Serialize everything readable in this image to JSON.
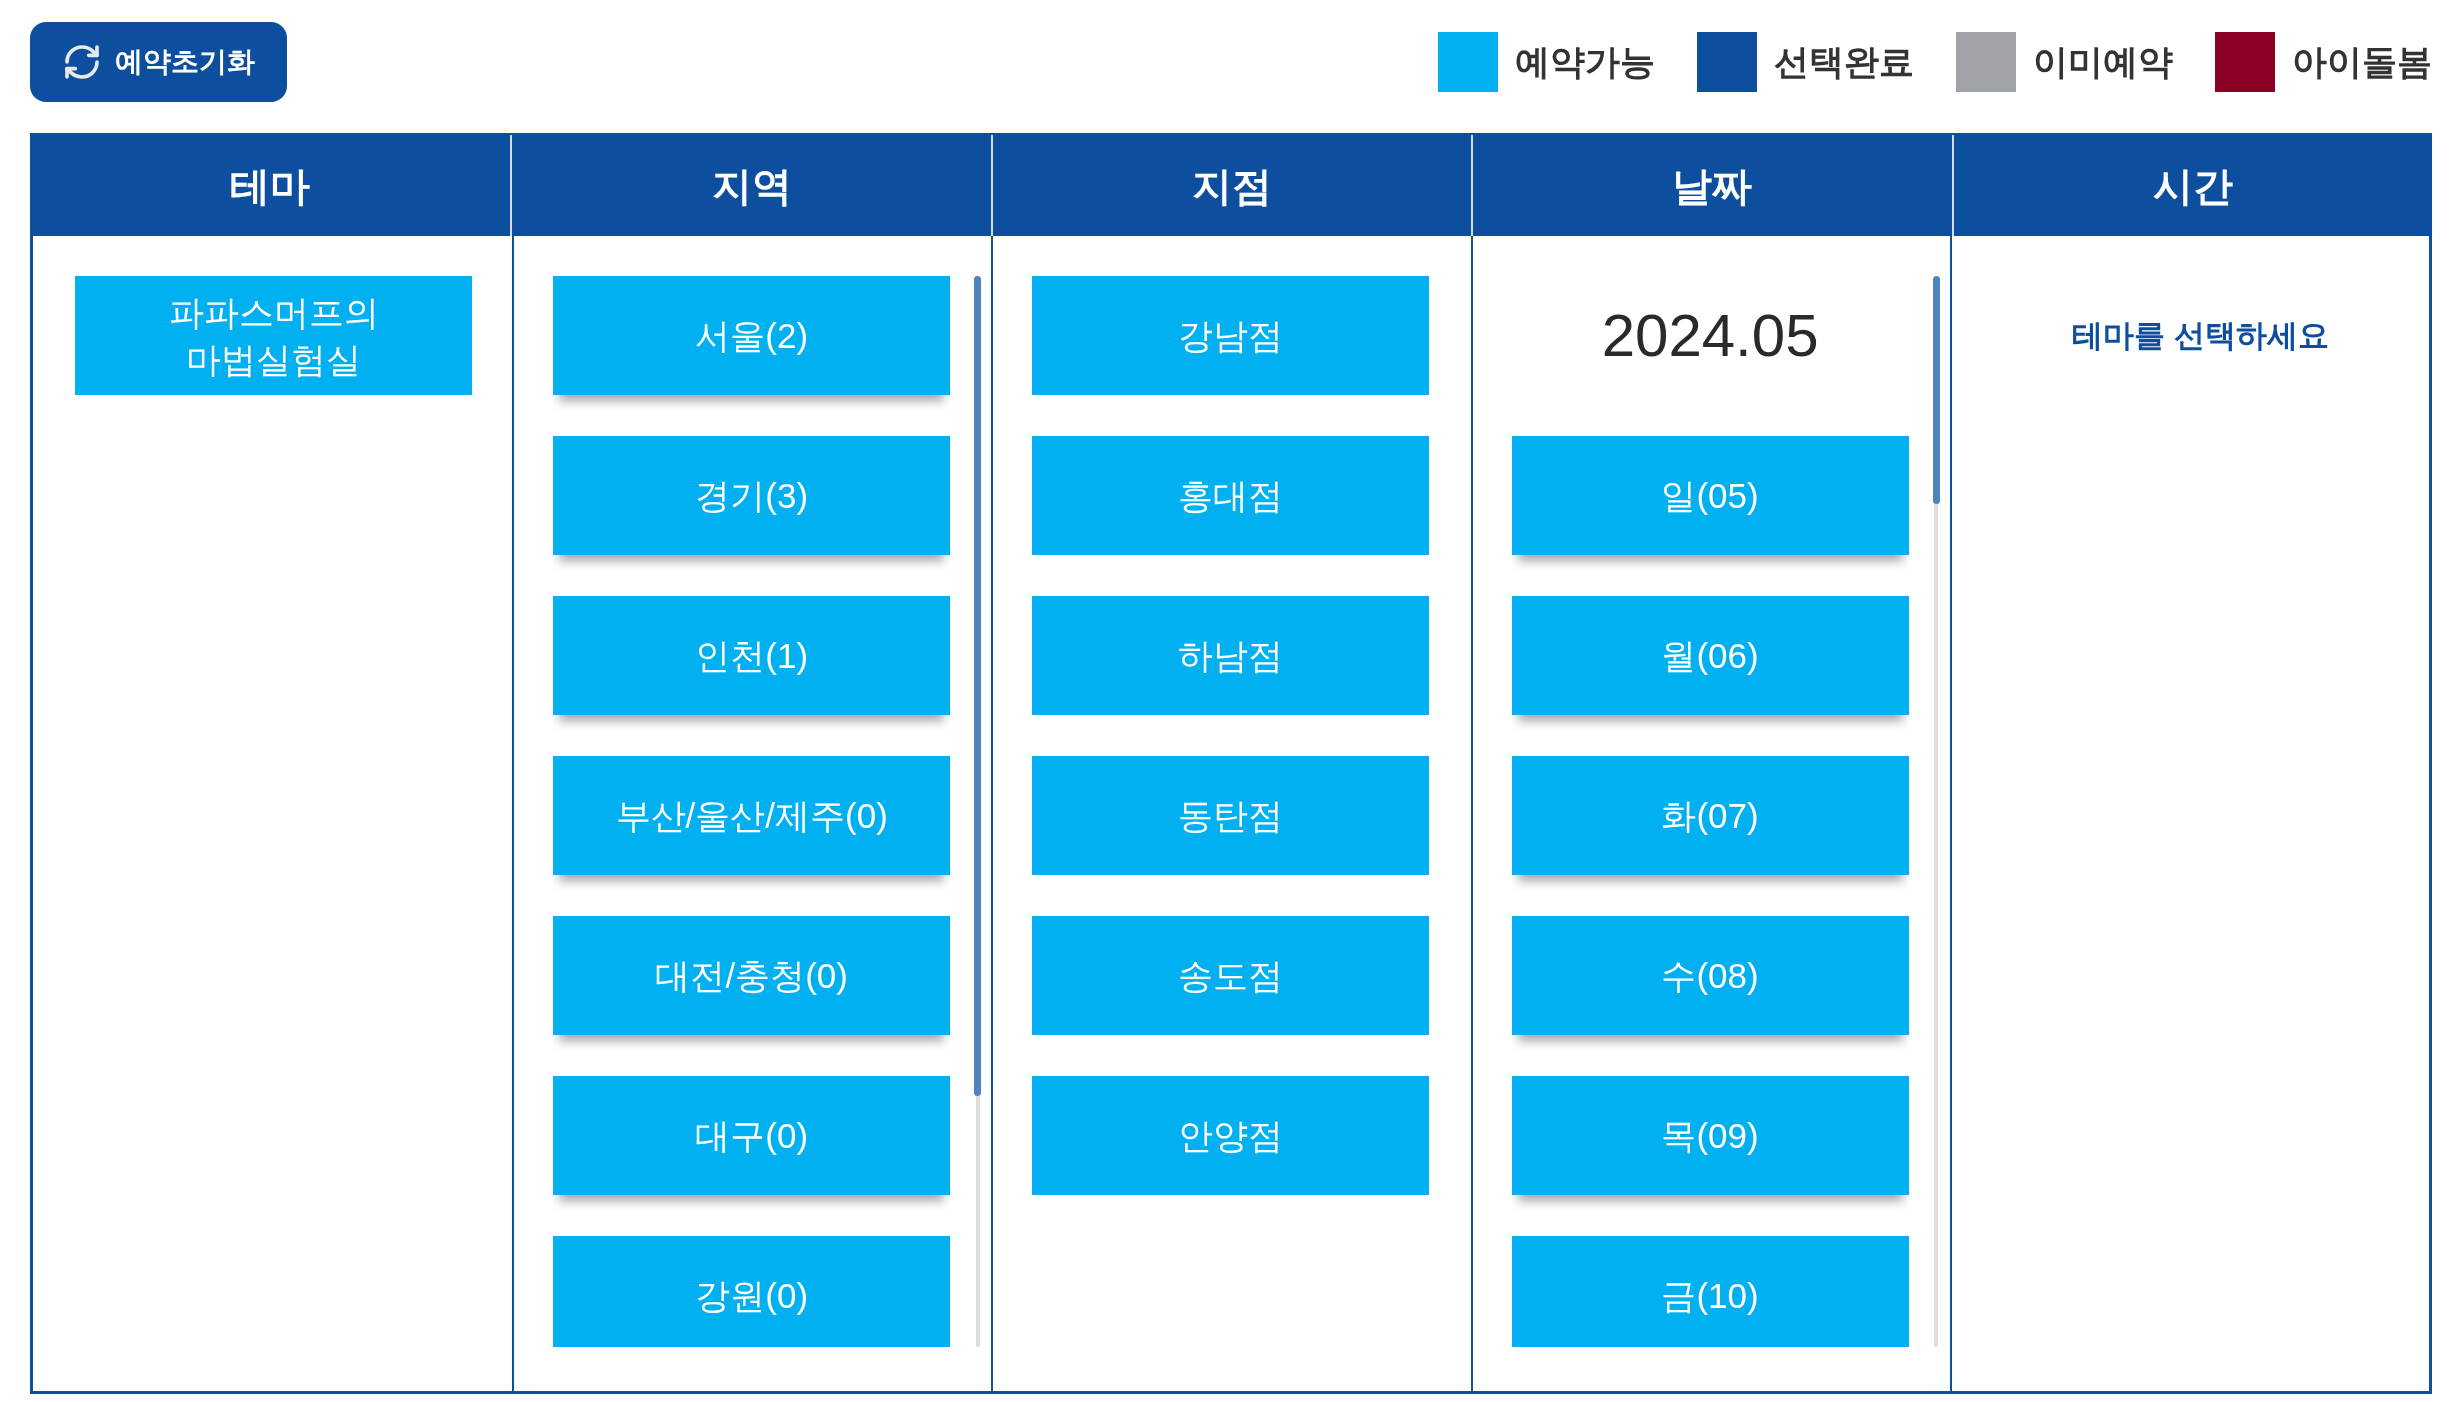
{
  "reset_button": {
    "label": "예약초기화"
  },
  "legend": [
    {
      "label": "예약가능",
      "color": "#00b0f0"
    },
    {
      "label": "선택완료",
      "color": "#0d4f9e"
    },
    {
      "label": "이미예약",
      "color": "#a0a3a8"
    },
    {
      "label": "아이돌봄",
      "color": "#8b0023"
    }
  ],
  "columns": [
    {
      "kind": "theme",
      "heading": "테마",
      "items": [
        {
          "label": "파파스머프의 마법실험실",
          "selected": false
        }
      ]
    },
    {
      "kind": "region",
      "heading": "지역",
      "items": [
        {
          "label": "서울(2)",
          "selected": false
        },
        {
          "label": "경기(3)",
          "selected": false
        },
        {
          "label": "인천(1)",
          "selected": false
        },
        {
          "label": "부산/울산/제주(0)",
          "selected": false
        },
        {
          "label": "대전/충청(0)",
          "selected": false
        },
        {
          "label": "대구(0)",
          "selected": false
        },
        {
          "label": "강원(0)",
          "selected": false
        }
      ]
    },
    {
      "kind": "branch",
      "heading": "지점",
      "items": [
        {
          "label": "강남점",
          "selected": false
        },
        {
          "label": "홍대점",
          "selected": false
        },
        {
          "label": "하남점",
          "selected": false
        },
        {
          "label": "동탄점",
          "selected": false
        },
        {
          "label": "송도점",
          "selected": false
        },
        {
          "label": "안양점",
          "selected": false
        }
      ]
    },
    {
      "kind": "date",
      "heading": "날짜",
      "month": "2024.05",
      "items": [
        {
          "label": "일(05)",
          "selected": false
        },
        {
          "label": "월(06)",
          "selected": false
        },
        {
          "label": "화(07)",
          "selected": false
        },
        {
          "label": "수(08)",
          "selected": false
        },
        {
          "label": "목(09)",
          "selected": false
        },
        {
          "label": "금(10)",
          "selected": false
        }
      ]
    },
    {
      "kind": "time",
      "heading": "시간",
      "message": "테마를 선택하세요"
    }
  ]
}
